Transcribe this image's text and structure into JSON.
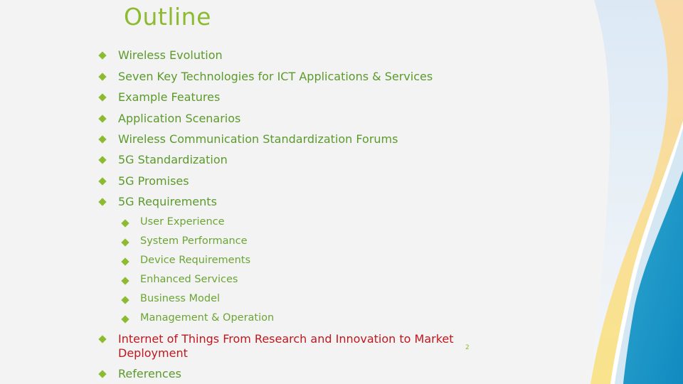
{
  "slide": {
    "title": "Outline",
    "page_number": "2",
    "accent_color": "#8dbb2f",
    "text_color": "#5b9a2b",
    "highlight_color": "#c0171e",
    "items": [
      {
        "label": "Wireless Evolution",
        "level": 1
      },
      {
        "label": "Seven Key Technologies for ICT Applications & Services",
        "level": 1
      },
      {
        "label": "Example Features",
        "level": 1
      },
      {
        "label": "Application Scenarios",
        "level": 1
      },
      {
        "label": "Wireless Communication Standardization Forums",
        "level": 1
      },
      {
        "label": "5G Standardization",
        "level": 1
      },
      {
        "label": "5G Promises",
        "level": 1
      },
      {
        "label": "5G Requirements",
        "level": 1
      },
      {
        "label": "User Experience",
        "level": 2
      },
      {
        "label": "System Performance",
        "level": 2
      },
      {
        "label": "Device Requirements",
        "level": 2
      },
      {
        "label": "Enhanced Services",
        "level": 2
      },
      {
        "label": "Business Model",
        "level": 2
      },
      {
        "label": "Management & Operation",
        "level": 2
      },
      {
        "label": "Internet of Things From Research and Innovation to Market Deployment",
        "level": 1,
        "highlighted": true
      },
      {
        "label": "References",
        "level": 1
      }
    ]
  }
}
